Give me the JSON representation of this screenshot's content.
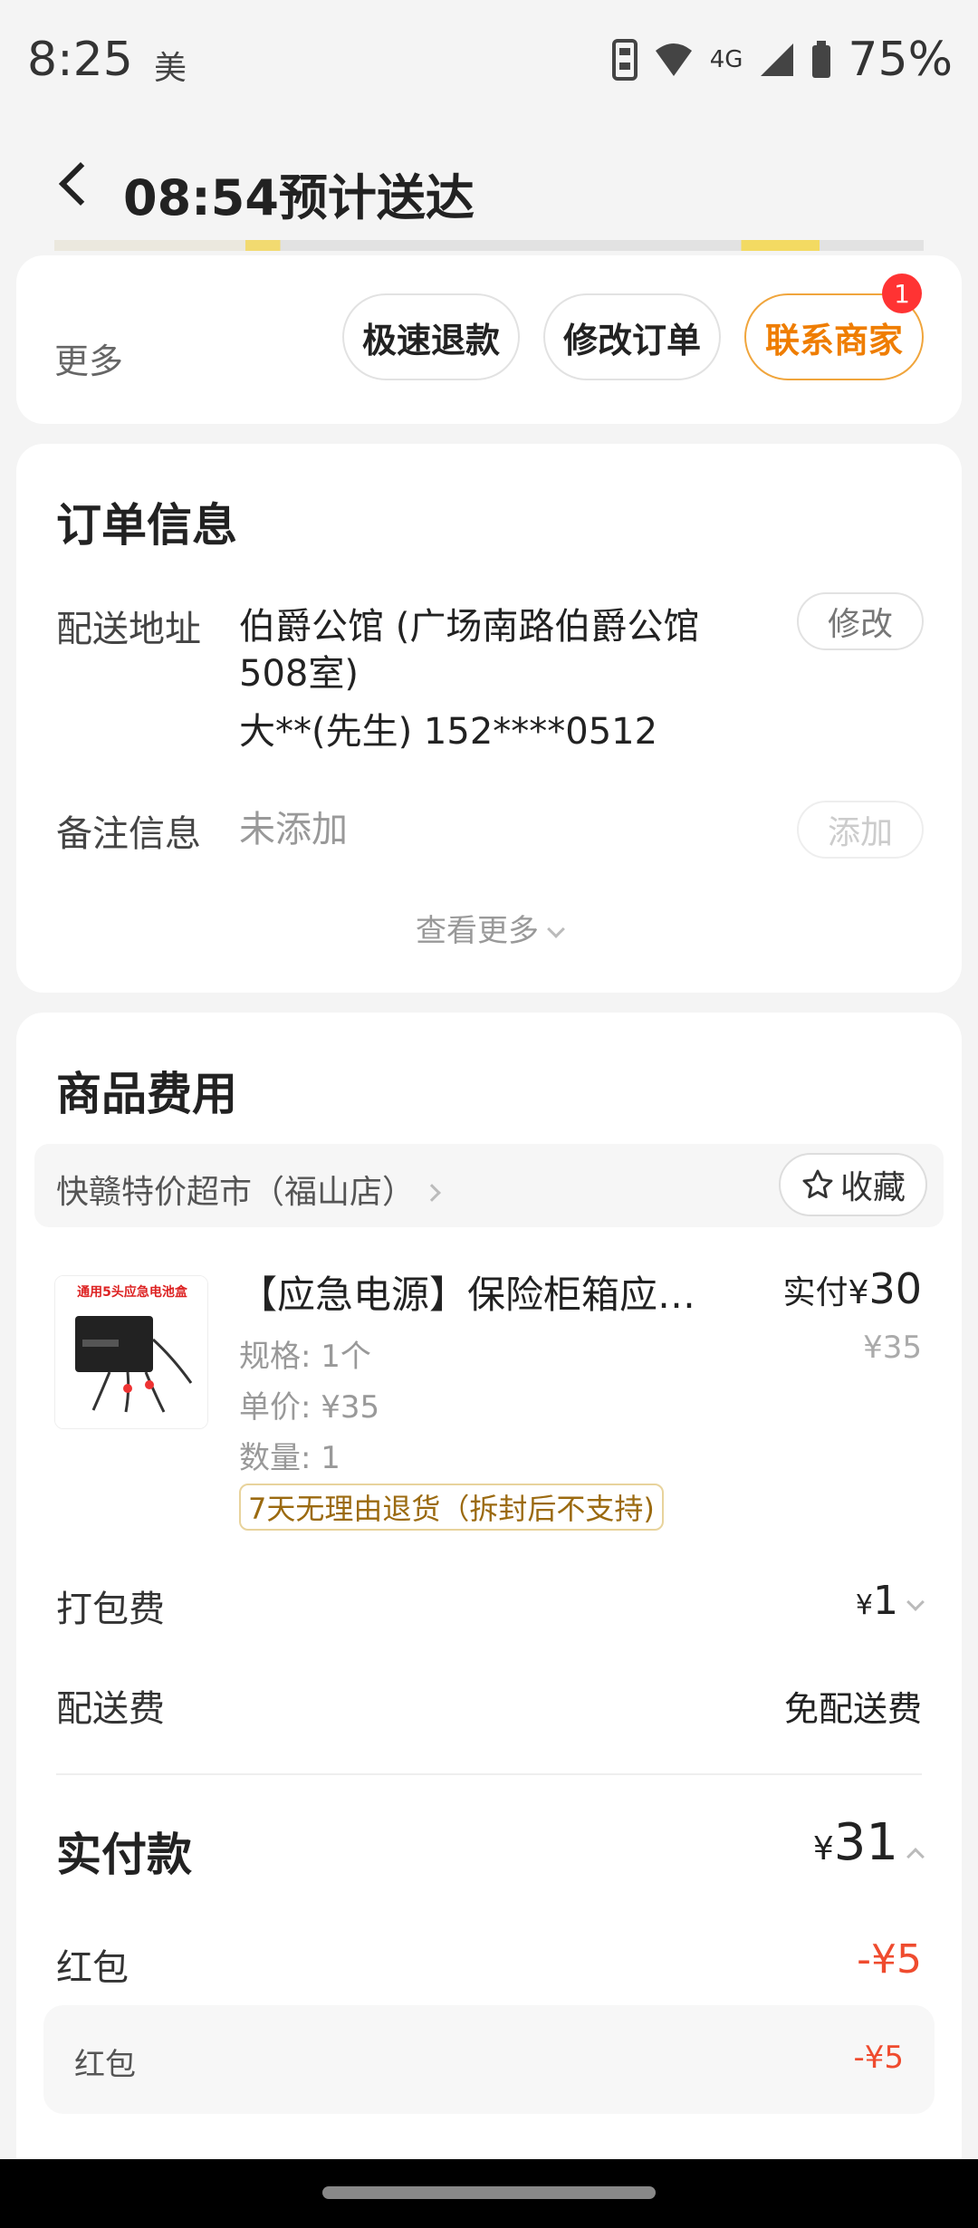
{
  "status_bar": {
    "time": "8:25",
    "app_badge": "美",
    "network": "4G",
    "battery": "75%"
  },
  "header": {
    "title": "08:54预计送达"
  },
  "actions": {
    "more_label": "更多",
    "buttons": [
      {
        "label": "极速退款"
      },
      {
        "label": "修改订单"
      },
      {
        "label": "联系商家",
        "badge": "1"
      }
    ]
  },
  "order_info": {
    "title": "订单信息",
    "address_label": "配送地址",
    "address_line1": "伯爵公馆 (广场南路伯爵公馆",
    "address_line2": "508室)",
    "address_contact": "大**(先生) 152****0512",
    "edit_label": "修改",
    "note_label": "备注信息",
    "note_value": "未添加",
    "add_label": "添加",
    "view_more": "查看更多"
  },
  "goods": {
    "title": "商品费用",
    "store_name": "快赣特价超市（福山店）",
    "favorite_label": "收藏",
    "product": {
      "thumb_caption": "通用5头应急电池盒",
      "title": "【应急电源】保险柜箱应急电源",
      "pay_label": "实付",
      "pay_currency": "¥",
      "pay_value": "30",
      "original_price": "¥35",
      "spec": "规格: 1个",
      "unit_price": "单价: ¥35",
      "quantity": "数量: 1",
      "return_tag": "7天无理由退货（拆封后不支持)"
    },
    "packing_fee_label": "打包费",
    "packing_fee_currency": "¥",
    "packing_fee_value": "1",
    "delivery_fee_label": "配送费",
    "delivery_fee_value": "免配送费",
    "total_label": "实付款",
    "total_currency": "¥",
    "total_value": "31",
    "red_packet_label": "红包",
    "red_packet_value": "-¥5",
    "red_packet_sub_label": "红包",
    "red_packet_sub_value": "-¥5"
  }
}
